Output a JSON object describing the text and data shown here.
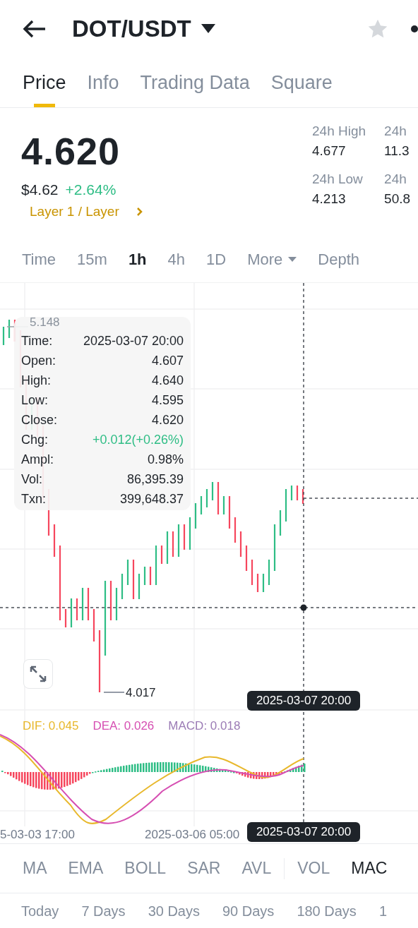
{
  "header": {
    "title": "DOT/USDT",
    "favorited": false
  },
  "tabs": [
    {
      "label": "Price",
      "selected": true
    },
    {
      "label": "Info",
      "selected": false
    },
    {
      "label": "Trading Data",
      "selected": false
    },
    {
      "label": "Square",
      "selected": false
    }
  ],
  "price": {
    "last": "4.620",
    "usd": "$4.62",
    "change": "+2.64%",
    "category": "Layer 1 / Layer"
  },
  "stats": [
    {
      "items": [
        {
          "label": "24h High",
          "value": "4.677"
        },
        {
          "label": "24h Low",
          "value": "4.213"
        }
      ]
    },
    {
      "items": [
        {
          "label": "24h",
          "value": "11.3"
        },
        {
          "label": "24h",
          "value": "50.8"
        }
      ]
    }
  ],
  "intervals": [
    {
      "label": "Time",
      "selected": false,
      "kind": "plain"
    },
    {
      "label": "15m",
      "selected": false,
      "kind": "plain"
    },
    {
      "label": "1h",
      "selected": true,
      "kind": "plain"
    },
    {
      "label": "4h",
      "selected": false,
      "kind": "plain"
    },
    {
      "label": "1D",
      "selected": false,
      "kind": "plain"
    },
    {
      "label": "More",
      "selected": false,
      "kind": "menu"
    },
    {
      "label": "Depth",
      "selected": false,
      "kind": "plain"
    }
  ],
  "chart": {
    "high_marker": "5.148",
    "low_marker": "4.017",
    "crosshair_time": "2025-03-07 20:00",
    "tooltip": [
      {
        "label": "Time:",
        "value": "2025-03-07 20:00",
        "kind": "plain"
      },
      {
        "label": "Open:",
        "value": "4.607",
        "kind": "plain"
      },
      {
        "label": "High:",
        "value": "4.640",
        "kind": "plain"
      },
      {
        "label": "Low:",
        "value": "4.595",
        "kind": "plain"
      },
      {
        "label": "Close:",
        "value": "4.620",
        "kind": "plain"
      },
      {
        "label": "Chg:",
        "value": "+0.012(+0.26%)",
        "kind": "change"
      },
      {
        "label": "Ampl:",
        "value": "0.98%",
        "kind": "plain"
      },
      {
        "label": "Vol:",
        "value": "86,395.39",
        "kind": "plain"
      },
      {
        "label": "Txn:",
        "value": "399,648.37",
        "kind": "plain"
      }
    ],
    "macd_legend": [
      {
        "label": "DIF: 0.045",
        "color": "#e8b82c"
      },
      {
        "label": "DEA: 0.026",
        "color": "#d64fb2"
      },
      {
        "label": "MACD: 0.018",
        "color": "#9b7bb5"
      }
    ],
    "x_labels": [
      "5-03-03 17:00",
      "2025-03-06 05:00"
    ],
    "axis_time": "2025-03-07 20:00"
  },
  "indicators": [
    {
      "label": "MA",
      "selected": false
    },
    {
      "label": "EMA",
      "selected": false
    },
    {
      "label": "BOLL",
      "selected": false
    },
    {
      "label": "SAR",
      "selected": false
    },
    {
      "label": "AVL",
      "selected": false
    },
    {
      "label": "VOL",
      "selected": false
    },
    {
      "label": "MAC",
      "selected": true
    }
  ],
  "periods": [
    "Today",
    "7 Days",
    "30 Days",
    "90 Days",
    "180 Days",
    "1"
  ]
}
